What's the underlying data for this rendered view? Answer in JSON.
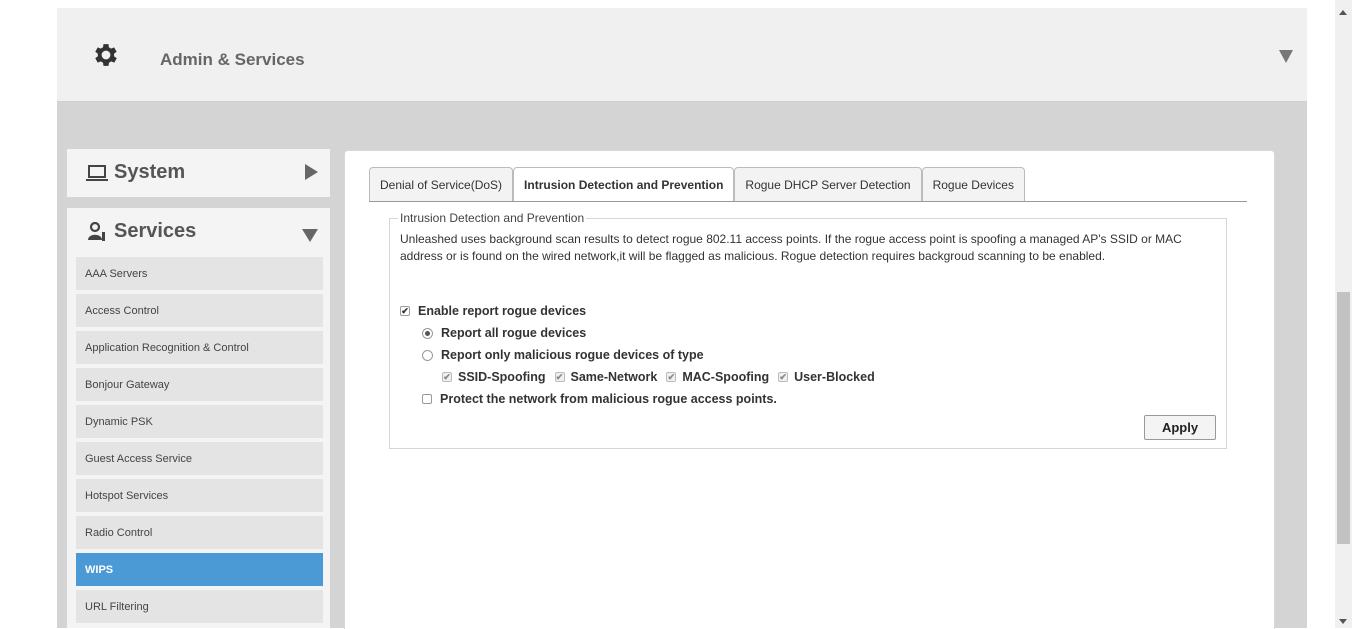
{
  "header": {
    "title": "Admin & Services",
    "icon": "gear-icon"
  },
  "sidebar": {
    "system_label": "System",
    "services_label": "Services",
    "items": [
      {
        "label": "AAA Servers",
        "active": false
      },
      {
        "label": "Access Control",
        "active": false
      },
      {
        "label": "Application Recognition & Control",
        "active": false
      },
      {
        "label": "Bonjour Gateway",
        "active": false
      },
      {
        "label": "Dynamic PSK",
        "active": false
      },
      {
        "label": "Guest Access Service",
        "active": false
      },
      {
        "label": "Hotspot Services",
        "active": false
      },
      {
        "label": "Radio Control",
        "active": false
      },
      {
        "label": "WIPS",
        "active": true
      },
      {
        "label": "URL Filtering",
        "active": false
      }
    ]
  },
  "tabs": [
    {
      "label": "Denial of Service(DoS)",
      "active": false
    },
    {
      "label": "Intrusion Detection and Prevention",
      "active": true
    },
    {
      "label": "Rogue DHCP Server Detection",
      "active": false
    },
    {
      "label": "Rogue Devices",
      "active": false
    }
  ],
  "panel": {
    "legend": "Intrusion Detection and Prevention",
    "description": "Unleashed uses background scan results to detect rogue 802.11 access points. If the rogue access point is spoofing a managed AP's SSID or MAC address or is found on the wired network,it will be flagged as malicious. Rogue detection requires backgroud scanning to be enabled.",
    "enable_report": {
      "label": "Enable report rogue devices",
      "checked": true
    },
    "report_all": {
      "label": "Report all rogue devices",
      "selected": true
    },
    "report_malicious": {
      "label": "Report only malicious rogue devices of type",
      "selected": false
    },
    "types": [
      {
        "label": "SSID-Spoofing",
        "checked": true
      },
      {
        "label": "Same-Network",
        "checked": true
      },
      {
        "label": "MAC-Spoofing",
        "checked": true
      },
      {
        "label": "User-Blocked",
        "checked": true
      }
    ],
    "protect": {
      "label": "Protect the network from malicious rogue access points.",
      "checked": false
    },
    "apply_label": "Apply"
  },
  "colors": {
    "accent": "#4b9ad6",
    "background": "#d4d4d4"
  }
}
